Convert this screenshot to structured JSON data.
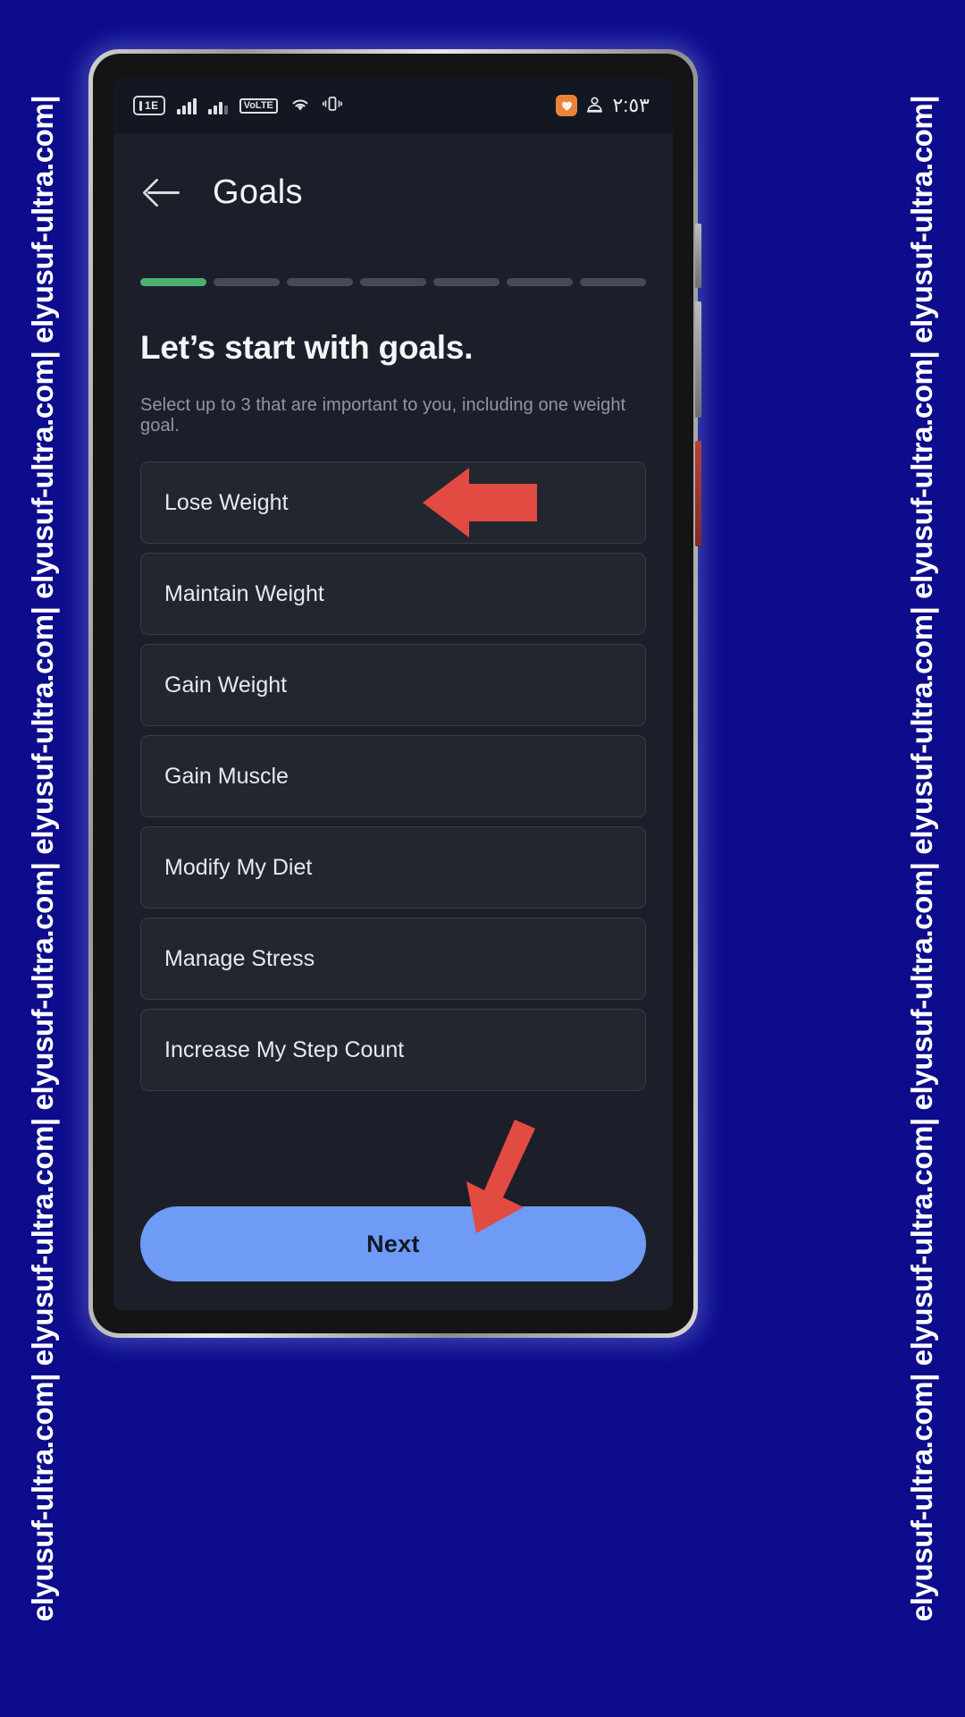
{
  "watermark": {
    "text": "elyusuf-ultra.com| elyusuf-ultra.com| elyusuf-ultra.com| elyusuf-ultra.com| elyusuf-ultra.com| elyusuf-ultra.com|",
    "color": "#ffffff",
    "background": "#0c0c8d"
  },
  "status_bar": {
    "sim_badge": "1E",
    "volte_label": "VoLTE",
    "icons": [
      "sim-card-icon",
      "signal-bars-icon",
      "signal-bars-secondary-icon",
      "volte-icon",
      "wifi-icon",
      "vibrate-icon",
      "app-notification-icon",
      "download-notification-icon"
    ],
    "wifi_glyph": "◠",
    "vibrate_glyph": "▒",
    "app_chip_glyph": "♥",
    "second_icon_glyph": "⚙",
    "clock": "٢:٥٣"
  },
  "appbar": {
    "back_icon": "arrow-left-icon",
    "title": "Goals"
  },
  "progress": {
    "total_steps": 7,
    "current_step": 1,
    "active_color": "#4caf72",
    "inactive_color": "#464a56"
  },
  "content": {
    "headline": "Let’s start with goals.",
    "subhead": "Select up to 3 that are important to you, including one weight goal.",
    "options": [
      {
        "label": "Lose Weight"
      },
      {
        "label": "Maintain Weight"
      },
      {
        "label": "Gain Weight"
      },
      {
        "label": "Gain Muscle"
      },
      {
        "label": "Modify My Diet"
      },
      {
        "label": "Manage Stress"
      },
      {
        "label": "Increase My Step Count"
      }
    ]
  },
  "footer": {
    "next_label": "Next",
    "next_color": "#6d9bf5"
  },
  "annotations": {
    "arrow_color": "#e24b42",
    "arrows": [
      "arrow-pointing-to-lose-weight",
      "arrow-pointing-to-next-button"
    ]
  }
}
